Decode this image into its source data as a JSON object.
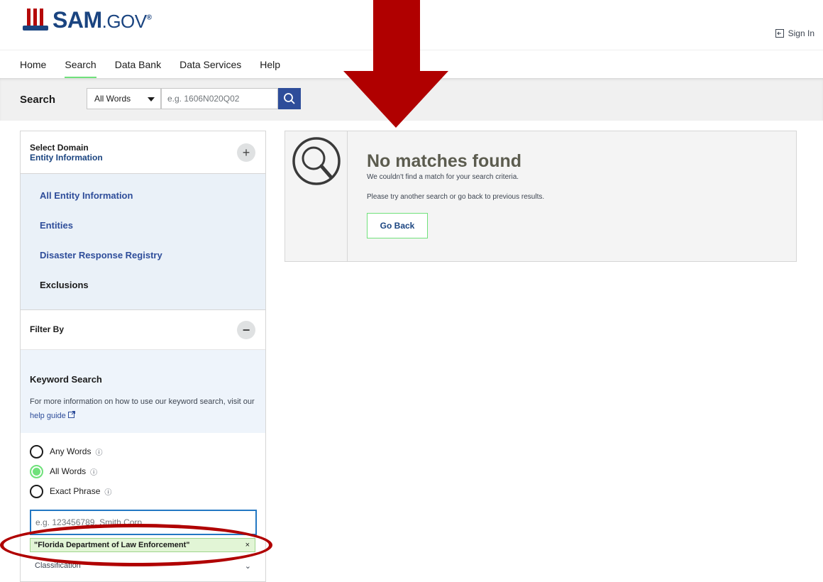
{
  "header": {
    "logo_text": "SAM",
    "logo_suffix": ".GOV",
    "logo_mark": "®",
    "signin_label": "Sign In"
  },
  "nav": {
    "items": [
      "Home",
      "Search",
      "Data Bank",
      "Data Services",
      "Help"
    ],
    "active": "Search"
  },
  "search_bar": {
    "label": "Search",
    "mode": "All Words",
    "placeholder": "e.g. 1606N020Q02"
  },
  "domain": {
    "heading": "Select Domain",
    "selected": "Entity Information",
    "items": [
      "All Entity Information",
      "Entities",
      "Disaster Response Registry",
      "Exclusions"
    ]
  },
  "filter": {
    "heading": "Filter By",
    "keyword_title": "Keyword Search",
    "keyword_desc": "For more information on how to use our keyword search, visit our",
    "help_link": "help guide",
    "options": [
      "Any Words",
      "All Words",
      "Exact Phrase"
    ],
    "selected_option": "All Words",
    "input_placeholder": "e.g. 123456789, Smith Corp.",
    "chip": "\"Florida Department of Law Enforcement\"",
    "next_section": "Classification"
  },
  "results": {
    "title": "No matches found",
    "subtitle": "We couldn't find a match for your search criteria.",
    "hint": "Please try another search or go back to previous results.",
    "go_back": "Go Back"
  },
  "colors": {
    "accent_green": "#70e17b",
    "brand_blue": "#1a4480",
    "annotation_red": "#b00000"
  }
}
